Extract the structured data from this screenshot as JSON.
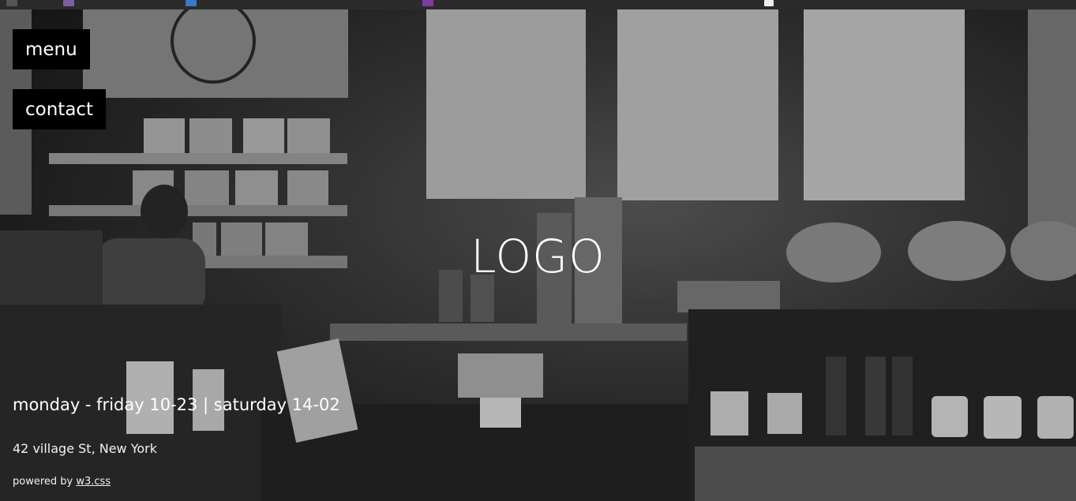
{
  "nav": {
    "menu_label": "menu",
    "contact_label": "contact"
  },
  "hero": {
    "logo_text": "LOGO",
    "background_image": "coffee-shop-counter-photo",
    "tone": "grayscale"
  },
  "info": {
    "hours": "monday - friday 10-23 | saturday 14-02",
    "address": "42 village St, New York"
  },
  "footer": {
    "powered_prefix": "powered by ",
    "powered_link": "w3.css"
  },
  "colors": {
    "nav_background": "#000000",
    "text": "#ffffff"
  }
}
